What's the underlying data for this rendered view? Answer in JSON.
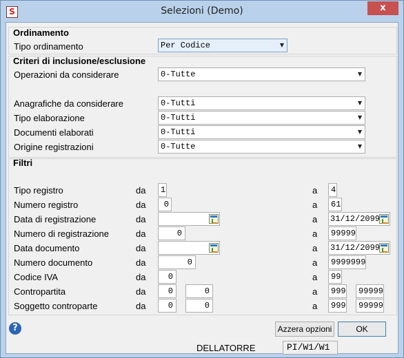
{
  "window": {
    "title": "Selezioni  (Demo)",
    "app_icon": "S",
    "close": "x"
  },
  "ordinamento": {
    "header": "Ordinamento",
    "tipo_label": "Tipo ordinamento",
    "tipo_value": "Per Codice"
  },
  "criteri": {
    "header": "Criteri di inclusione/esclusione",
    "operazioni_label": "Operazioni da considerare",
    "operazioni_value": "0-Tutte",
    "anagrafiche_label": "Anagrafiche da considerare",
    "anagrafiche_value": "0-Tutti",
    "elaborazione_label": "Tipo elaborazione",
    "elaborazione_value": "0-Tutti",
    "documenti_label": "Documenti elaborati",
    "documenti_value": "0-Tutti",
    "origine_label": "Origine registrazioni",
    "origine_value": "0-Tutte"
  },
  "filtri": {
    "header": "Filtri",
    "da": "da",
    "a": "a",
    "rows": {
      "tipo_registro": {
        "label": "Tipo registro",
        "from": "1",
        "to": "4"
      },
      "numero_registro": {
        "label": "Numero registro",
        "from": "0",
        "to": "61"
      },
      "data_registrazione": {
        "label": "Data di registrazione",
        "from": "",
        "to": "31/12/2099"
      },
      "numero_registrazione": {
        "label": "Numero di registrazione",
        "from": "0",
        "to": "99999"
      },
      "data_documento": {
        "label": "Data documento",
        "from": "",
        "to": "31/12/2099"
      },
      "numero_documento": {
        "label": "Numero documento",
        "from": "0",
        "to": "9999999"
      },
      "codice_iva": {
        "label": "Codice IVA",
        "from": "0",
        "to": "99"
      },
      "contropartita": {
        "label": "Contropartita",
        "from_1": "0",
        "from_2": "0",
        "to_1": "999",
        "to_2": "99999"
      },
      "soggetto": {
        "label": "Soggetto controparte",
        "from_1": "0",
        "from_2": "0",
        "to_1": "999",
        "to_2": "99999"
      }
    }
  },
  "buttons": {
    "reset": "Azzera opzioni",
    "ok": "OK",
    "help": "?"
  },
  "status": {
    "user": "DELLATORRE",
    "code": "PI/W1/W1"
  }
}
